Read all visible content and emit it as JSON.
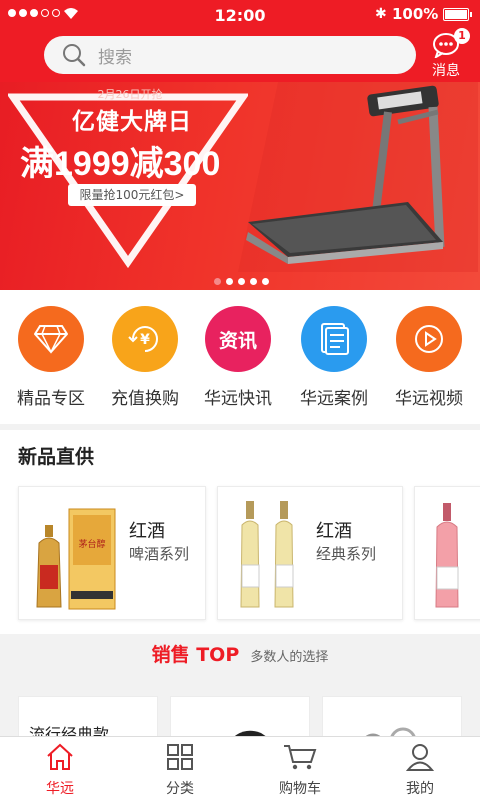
{
  "status_bar": {
    "time": "12:00",
    "battery": "100%"
  },
  "search": {
    "placeholder": "搜索"
  },
  "messages": {
    "label": "消息",
    "badge": "1"
  },
  "banner": {
    "date": "2月26日开抢",
    "title": "亿健大牌日",
    "promo": "满1999减300",
    "coupon": "限量抢100元红包>"
  },
  "categories": [
    {
      "label": "精品专区",
      "color": "#f56a1e",
      "icon": "diamond-icon"
    },
    {
      "label": "充值换购",
      "color": "#f8a41a",
      "icon": "yen-exchange-icon"
    },
    {
      "label": "华远快讯",
      "color": "#e8225f",
      "icon": "news-icon",
      "icon_text": "资讯"
    },
    {
      "label": "华远案例",
      "color": "#2a9bef",
      "icon": "document-icon"
    },
    {
      "label": "华远视频",
      "color": "#f56a1e",
      "icon": "play-icon"
    }
  ],
  "new_products": {
    "title": "新品直供",
    "items": [
      {
        "title": "红酒",
        "subtitle": "啤酒系列"
      },
      {
        "title": "红酒",
        "subtitle": "经典系列"
      }
    ]
  },
  "sales_top": {
    "title": "销售 TOP",
    "subtitle": "多数人的选择"
  },
  "bottom_cards": {
    "first_title": "流行经典款"
  },
  "tabbar": [
    {
      "label": "华远",
      "active": true
    },
    {
      "label": "分类",
      "active": false
    },
    {
      "label": "购物车",
      "active": false
    },
    {
      "label": "我的",
      "active": false
    }
  ]
}
